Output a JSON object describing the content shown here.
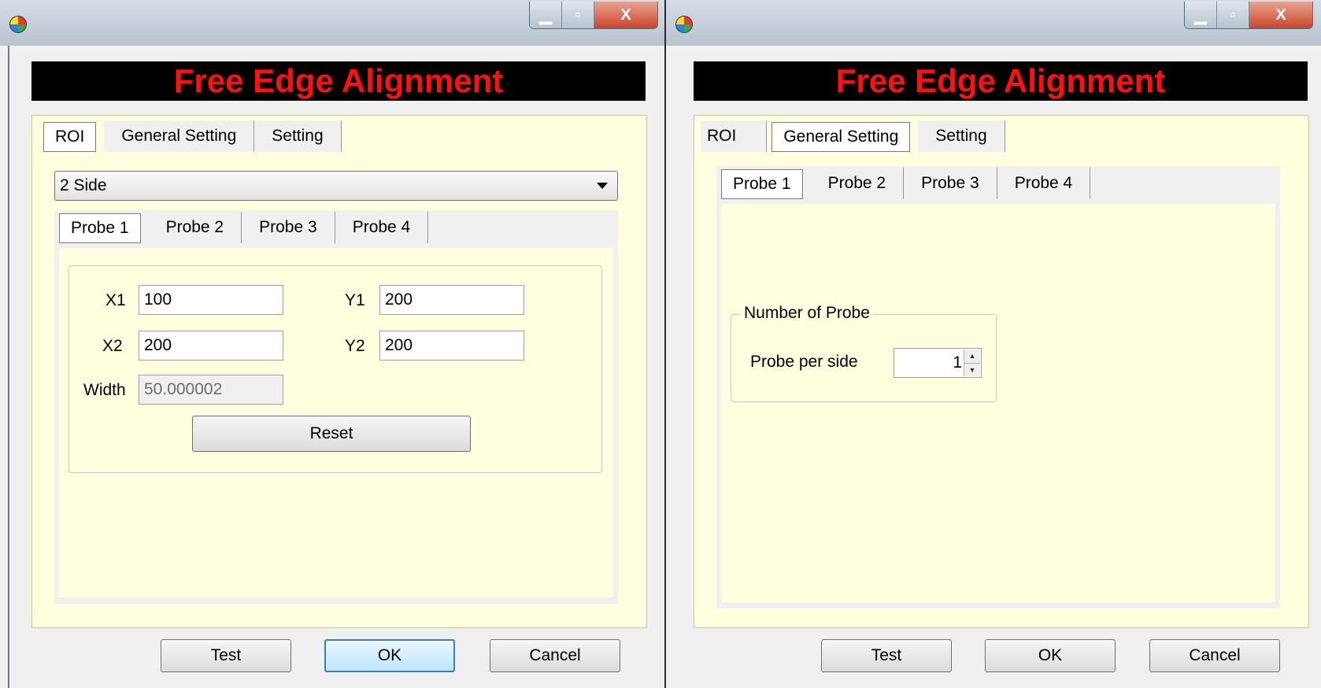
{
  "left_window": {
    "app_icon": "app-logo-icon",
    "caption_buttons": {
      "minimize": "minimize-icon",
      "maximize": "maximize-icon",
      "close": "X"
    },
    "banner": "Free Edge Alignment",
    "tabs": [
      "ROI",
      "General Setting",
      "Setting"
    ],
    "active_tab": "ROI",
    "side_combo": {
      "value": "2 Side",
      "icon": "chevron-down-icon"
    },
    "probe_tabs": [
      "Probe 1",
      "Probe 2",
      "Probe 3",
      "Probe 4"
    ],
    "active_probe_tab": "Probe 1",
    "roi": {
      "x1_label": "X1",
      "x1_value": "100",
      "y1_label": "Y1",
      "y1_value": "200",
      "x2_label": "X2",
      "x2_value": "200",
      "y2_label": "Y2",
      "y2_value": "200",
      "width_label": "Width",
      "width_value": "50.000002",
      "reset_label": "Reset"
    },
    "footer": {
      "test": "Test",
      "ok": "OK",
      "cancel": "Cancel"
    }
  },
  "right_window": {
    "app_icon": "app-logo-icon",
    "caption_buttons": {
      "minimize": "minimize-icon",
      "maximize": "maximize-icon",
      "close": "X"
    },
    "banner": "Free Edge Alignment",
    "tabs": [
      "ROI",
      "General Setting",
      "Setting"
    ],
    "active_tab": "General Setting",
    "probe_tabs": [
      "Probe 1",
      "Probe 2",
      "Probe 3",
      "Probe 4"
    ],
    "active_probe_tab": "Probe 1",
    "group_title": "Number of Probe",
    "probe_per_side_label": "Probe per side",
    "probe_per_side_value": "1",
    "footer": {
      "test": "Test",
      "ok": "OK",
      "cancel": "Cancel"
    }
  },
  "colors": {
    "banner_bg": "#000000",
    "banner_text": "#ff1010",
    "panel_bg": "#ffffe0",
    "dialog_bg": "#f0f0f0"
  }
}
